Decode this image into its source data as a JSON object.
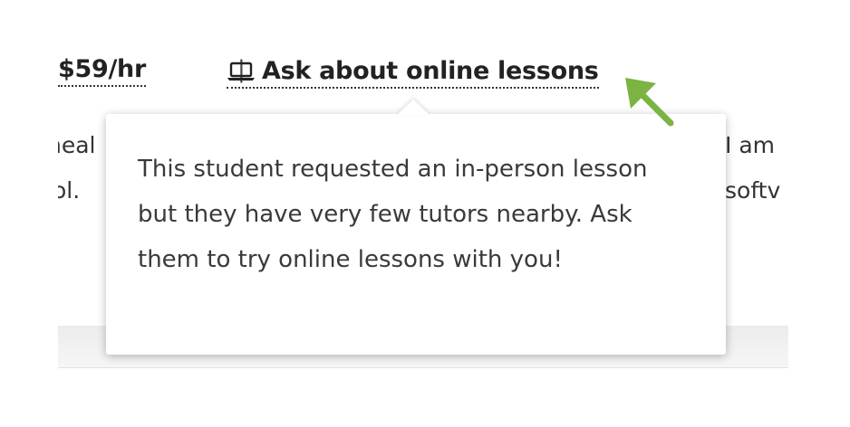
{
  "meta": {
    "rate": "$59/hr",
    "divider": "|",
    "online_label": "Ask about online lessons",
    "online_icon": "laptop-icon"
  },
  "background_text": {
    "left_line_1": "neal",
    "left_line_2": "ol.",
    "right_line_1": "I am",
    "right_line_2": "softv"
  },
  "popover": {
    "text": "This student requested an in-person lesson but they have very few tutors nearby. Ask them to try online lessons with you!"
  },
  "annotation": {
    "arrow_icon": "green-pointer-arrow-icon",
    "arrow_color": "#7cb342"
  }
}
